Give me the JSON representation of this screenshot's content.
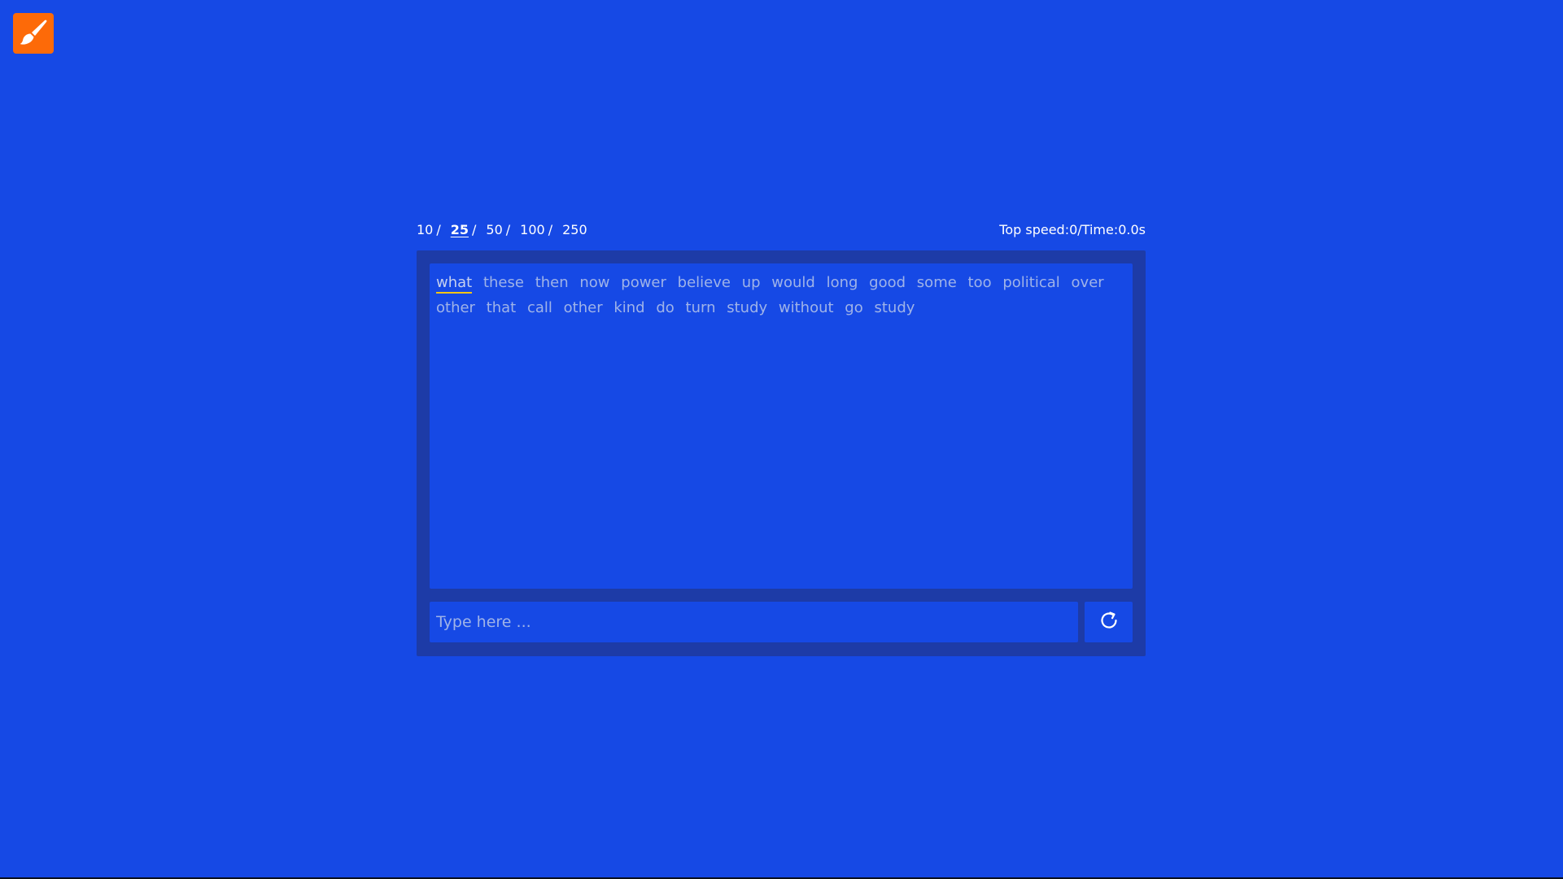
{
  "colors": {
    "background": "#1649e5",
    "panel": "#1d3ba7",
    "logo": "#fd6a08",
    "cursor_underline": "#fac515",
    "word_text": "#9fb3e8"
  },
  "logo": {
    "icon": "paintbrush-icon"
  },
  "word_counts": {
    "options": [
      {
        "label": "10",
        "sep": "/"
      },
      {
        "label": "25",
        "sep": "/"
      },
      {
        "label": "50",
        "sep": "/"
      },
      {
        "label": "100",
        "sep": "/"
      },
      {
        "label": "250",
        "sep": ""
      }
    ],
    "selected": "25"
  },
  "stats": {
    "top_speed_label": "Top speed:",
    "top_speed_value": "0",
    "separator": "/",
    "time_label": "Time:",
    "time_value": "0.0s"
  },
  "words": [
    "what",
    "these",
    "then",
    "now",
    "power",
    "believe",
    "up",
    "would",
    "long",
    "good",
    "some",
    "too",
    "political",
    "over",
    "other",
    "that",
    "call",
    "other",
    "kind",
    "do",
    "turn",
    "study",
    "without",
    "go",
    "study"
  ],
  "current_word_index": 0,
  "input": {
    "value": "",
    "placeholder": "Type here ..."
  },
  "reset_button": {
    "icon": "refresh-icon"
  }
}
